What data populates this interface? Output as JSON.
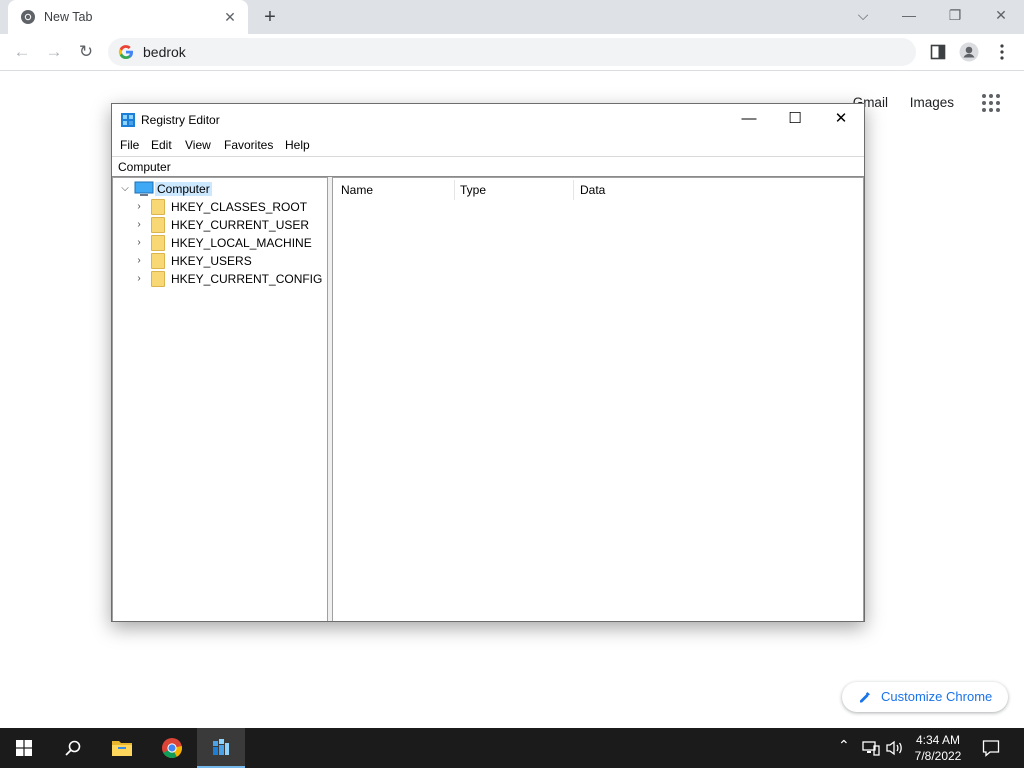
{
  "browser": {
    "tab_title": "New Tab",
    "tab_close": "✕",
    "new_tab": "+",
    "window_buttons": {
      "tabsearch": "⌵",
      "minimize": "—",
      "restore": "❐",
      "close": "✕"
    },
    "nav": {
      "back": "←",
      "forward": "→",
      "reload": "↻"
    },
    "omnibox_text": "bedrok",
    "toolbar_icons": [
      "side-panel-icon",
      "profile-icon",
      "menu-kebab-icon"
    ]
  },
  "ntp": {
    "links": [
      "Gmail",
      "Images"
    ],
    "customize_label": "Customize Chrome"
  },
  "regedit": {
    "title": "Registry Editor",
    "window_buttons": {
      "minimize": "—",
      "maximize": "☐",
      "close": "✕"
    },
    "menu": [
      "File",
      "Edit",
      "View",
      "Favorites",
      "Help"
    ],
    "address": "Computer",
    "tree": {
      "root": {
        "label": "Computer",
        "expanded": true
      },
      "children": [
        "HKEY_CLASSES_ROOT",
        "HKEY_CURRENT_USER",
        "HKEY_LOCAL_MACHINE",
        "HKEY_USERS",
        "HKEY_CURRENT_CONFIG"
      ]
    },
    "columns": [
      "Name",
      "Type",
      "Data"
    ]
  },
  "taskbar": {
    "items": [
      "start-icon",
      "search-icon",
      "file-explorer-icon",
      "chrome-icon",
      "regedit-icon"
    ],
    "time": "4:34 AM",
    "date": "7/8/2022"
  },
  "colors": {
    "accent": "#1a73e8",
    "taskbar": "#1b1b1b",
    "selection": "#cce8ff",
    "folder": "#f8d775"
  }
}
